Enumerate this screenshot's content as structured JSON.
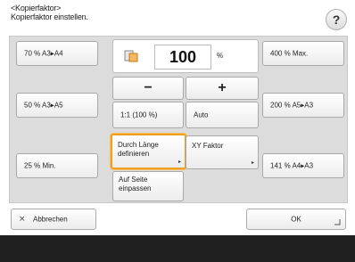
{
  "header": {
    "title_line1": "<Kopierfaktor>",
    "title_line2": "Kopierfaktor einstellen.",
    "help_label": "?"
  },
  "left_presets": [
    {
      "label": "70 % A3▸A4"
    },
    {
      "label": "50 % A3▸A5"
    },
    {
      "label": "25 % Min."
    }
  ],
  "right_presets": [
    {
      "label": "400 % Max."
    },
    {
      "label": "200 % A5▸A3"
    },
    {
      "label": "141 % A4▸A3"
    }
  ],
  "display": {
    "value": "100",
    "unit": "%"
  },
  "controls": {
    "minus": "−",
    "plus": "+",
    "one_to_one": "1:1 (100 %)",
    "auto": "Auto",
    "by_length_line1": "Durch Länge",
    "by_length_line2": "definieren",
    "xy_factor": "XY Faktor",
    "fit_page_line1": "Auf Seite",
    "fit_page_line2": "einpassen"
  },
  "footer": {
    "cancel": "Abbrechen",
    "cancel_icon": "✕",
    "ok": "OK"
  }
}
